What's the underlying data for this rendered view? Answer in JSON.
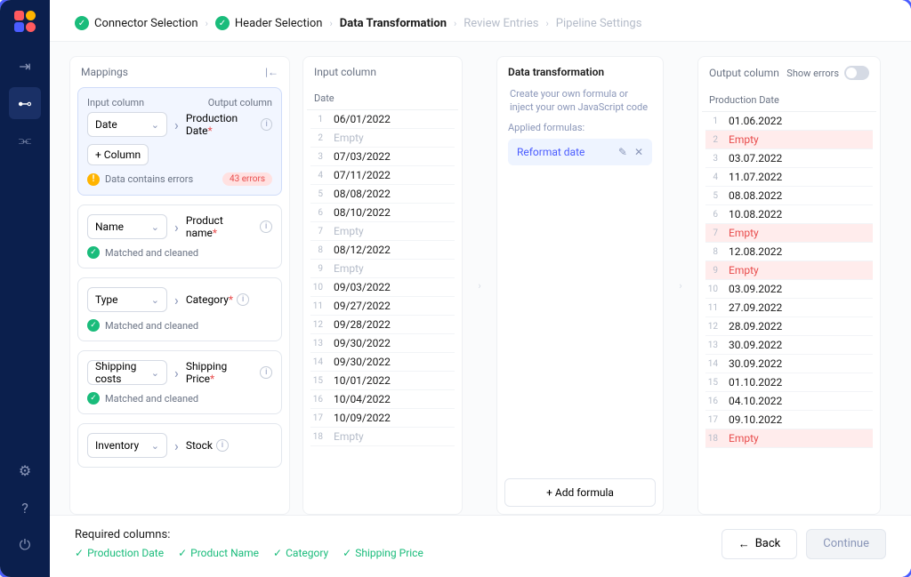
{
  "breadcrumbs": {
    "steps": [
      {
        "label": "Connector Selection",
        "state": "done"
      },
      {
        "label": "Header Selection",
        "state": "done"
      },
      {
        "label": "Data Transformation",
        "state": "current"
      },
      {
        "label": "Review Entries",
        "state": "future"
      },
      {
        "label": "Pipeline Settings",
        "state": "future"
      }
    ]
  },
  "mappings": {
    "title": "Mappings",
    "input_label": "Input column",
    "output_label": "Output column",
    "add_column": "+ Column",
    "error_text": "Data contains errors",
    "error_badge": "43 errors",
    "matched_text": "Matched and cleaned",
    "items": [
      {
        "input": "Date",
        "output": "Production Date",
        "required": true,
        "active": true,
        "has_errors": true
      },
      {
        "input": "Name",
        "output": "Product name",
        "required": true,
        "active": false,
        "matched": true
      },
      {
        "input": "Type",
        "output": "Category",
        "required": true,
        "active": false,
        "matched": true
      },
      {
        "input": "Shipping costs",
        "output": "Shipping Price",
        "required": true,
        "active": false,
        "matched": true
      },
      {
        "input": "Inventory",
        "output": "Stock",
        "required": false,
        "active": false
      }
    ]
  },
  "input_column": {
    "title": "Input column",
    "header": "Date",
    "rows": [
      {
        "n": 1,
        "v": "06/01/2022"
      },
      {
        "n": 2,
        "v": "Empty",
        "empty": true
      },
      {
        "n": 3,
        "v": "07/03/2022"
      },
      {
        "n": 4,
        "v": "07/11/2022"
      },
      {
        "n": 5,
        "v": "08/08/2022"
      },
      {
        "n": 6,
        "v": "08/10/2022"
      },
      {
        "n": 7,
        "v": "Empty",
        "empty": true
      },
      {
        "n": 8,
        "v": "08/12/2022"
      },
      {
        "n": 9,
        "v": "Empty",
        "empty": true
      },
      {
        "n": 10,
        "v": "09/03/2022"
      },
      {
        "n": 11,
        "v": "09/27/2022"
      },
      {
        "n": 12,
        "v": "09/28/2022"
      },
      {
        "n": 13,
        "v": "09/30/2022"
      },
      {
        "n": 14,
        "v": "09/30/2022"
      },
      {
        "n": 15,
        "v": "10/01/2022"
      },
      {
        "n": 16,
        "v": "10/04/2022"
      },
      {
        "n": 17,
        "v": "10/09/2022"
      },
      {
        "n": 18,
        "v": "Empty",
        "empty": true
      }
    ]
  },
  "transform": {
    "title": "Data transformation",
    "desc": "Create your own formula or inject your own JavaScript code",
    "applied_label": "Applied formulas:",
    "formula": "Reformat date",
    "add_formula": "Add formula"
  },
  "output_column": {
    "title": "Output column",
    "show_errors": "Show errors",
    "header": "Production Date",
    "rows": [
      {
        "n": 1,
        "v": "01.06.2022"
      },
      {
        "n": 2,
        "v": "Empty",
        "err": true
      },
      {
        "n": 3,
        "v": "03.07.2022"
      },
      {
        "n": 4,
        "v": "11.07.2022"
      },
      {
        "n": 5,
        "v": "08.08.2022"
      },
      {
        "n": 6,
        "v": "10.08.2022"
      },
      {
        "n": 7,
        "v": "Empty",
        "err": true
      },
      {
        "n": 8,
        "v": "12.08.2022"
      },
      {
        "n": 9,
        "v": "Empty",
        "err": true
      },
      {
        "n": 10,
        "v": "03.09.2022"
      },
      {
        "n": 11,
        "v": "27.09.2022"
      },
      {
        "n": 12,
        "v": "28.09.2022"
      },
      {
        "n": 13,
        "v": "30.09.2022"
      },
      {
        "n": 14,
        "v": "30.09.2022"
      },
      {
        "n": 15,
        "v": "01.10.2022"
      },
      {
        "n": 16,
        "v": "04.10.2022"
      },
      {
        "n": 17,
        "v": "09.10.2022"
      },
      {
        "n": 18,
        "v": "Empty",
        "err": true
      }
    ]
  },
  "footer": {
    "required_label": "Required columns:",
    "required": [
      "Production Date",
      "Product Name",
      "Category",
      "Shipping Price"
    ],
    "back": "Back",
    "continue": "Continue"
  }
}
